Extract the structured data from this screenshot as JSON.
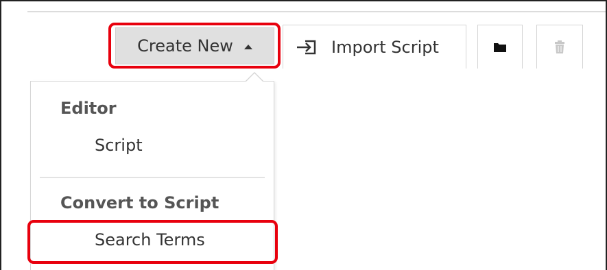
{
  "toolbar": {
    "create_new_label": "Create New",
    "import_script_label": "Import Script",
    "icons": {
      "caret": "caret-up-icon",
      "import": "import-icon",
      "folder": "folder-icon",
      "trash": "trash-icon"
    }
  },
  "dropdown": {
    "sections": [
      {
        "header": "Editor",
        "items": [
          "Script"
        ]
      },
      {
        "header": "Convert to Script",
        "items": [
          "Search Terms"
        ]
      }
    ]
  },
  "colors": {
    "highlight": "#e8000d",
    "create_button_bg": "#e0e0e0",
    "trash_icon_disabled": "#c8c8c8"
  }
}
